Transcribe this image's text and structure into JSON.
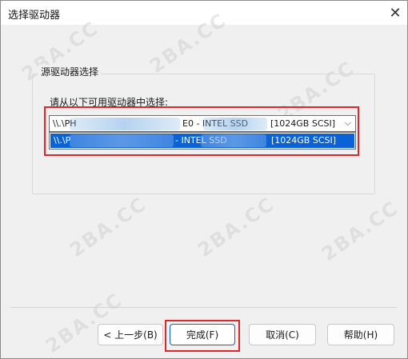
{
  "window": {
    "title": "选择驱动器",
    "close_icon": "close-icon"
  },
  "group": {
    "label": "源驱动器选择",
    "prompt": "请从以下可用驱动器中选择:"
  },
  "drive_select": {
    "selected_prefix": "\\\\.\\PH",
    "selected_middle": "E0 - INTEL SSD",
    "selected_size": "[1024GB SCSI]",
    "arrow_icon": "chevron-down-icon"
  },
  "drive_option": {
    "prefix": "\\\\.\\P",
    "middle": "- INTEL SSD",
    "size": "[1024GB SCSI]"
  },
  "buttons": {
    "back": "< 上一步(B)",
    "finish": "完成(F)",
    "cancel": "取消(C)",
    "help": "帮助(H)"
  },
  "watermark": "2BA.CC",
  "colors": {
    "selection": "#0b61d6",
    "highlight_frame": "#e0262a"
  }
}
